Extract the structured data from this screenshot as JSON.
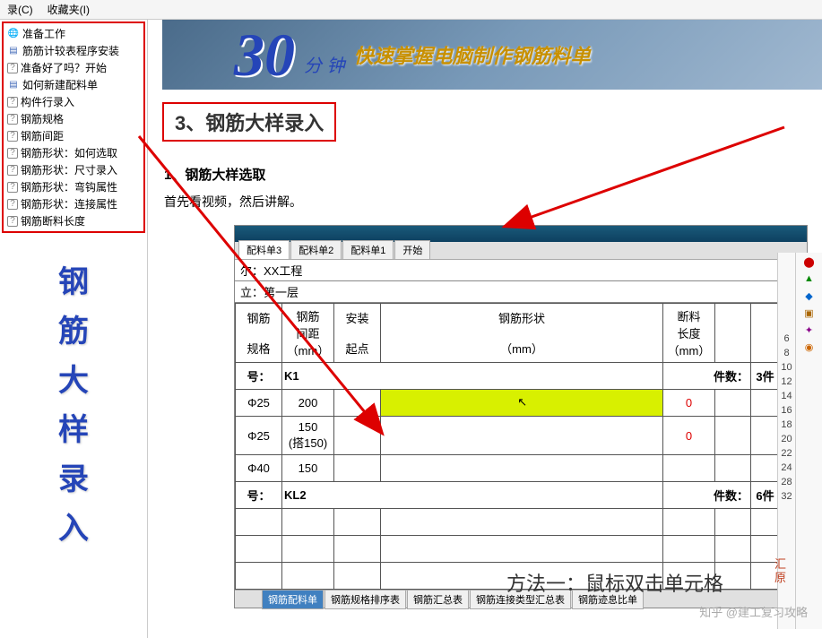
{
  "menu": {
    "item1": "录(C)",
    "item2": "收藏夹(I)"
  },
  "sidebar": {
    "items": [
      {
        "icon": "globe",
        "label": "准备工作"
      },
      {
        "icon": "doc",
        "label": "筋筋计较表程序安装"
      },
      {
        "icon": "q",
        "label": "准备好了吗？开始"
      },
      {
        "icon": "doc",
        "label": "如何新建配料单"
      },
      {
        "icon": "q",
        "label": "构件行录入"
      },
      {
        "icon": "q",
        "label": "钢筋规格"
      },
      {
        "icon": "q",
        "label": "钢筋间距"
      },
      {
        "icon": "q",
        "label": "钢筋形状：如何选取"
      },
      {
        "icon": "q",
        "label": "钢筋形状：尺寸录入"
      },
      {
        "icon": "q",
        "label": "钢筋形状：弯钩属性"
      },
      {
        "icon": "q",
        "label": "钢筋形状：连接属性"
      },
      {
        "icon": "q",
        "label": "钢筋断料长度"
      }
    ],
    "vertical": [
      "钢",
      "筋",
      "大",
      "样",
      "录",
      "入"
    ]
  },
  "banner": {
    "num": "30",
    "unit": "分 钟",
    "text": "快速掌握电脑制作钢筋料单"
  },
  "section": {
    "title": "3、钢筋大样录入",
    "sub": "1、钢筋大样选取",
    "body": "首先看视频，然后讲解。"
  },
  "app": {
    "tabs": [
      "配料单3",
      "配料单2",
      "配料单1",
      "开始"
    ],
    "info1": "尔：XX工程",
    "info2": "立：第一层",
    "headers": {
      "c1a": "钢筋",
      "c1b": "规格",
      "c2a": "钢筋",
      "c2b": "间距",
      "c2c": "（mm）",
      "c3a": "安装",
      "c3b": "起点",
      "c4a": "钢筋形状",
      "c4b": "（mm）",
      "c5a": "断料",
      "c5b": "长度",
      "c5c": "（mm）"
    },
    "rows": {
      "g1_label": "号：",
      "g1_val": "K1",
      "g1_cnt_label": "件数：",
      "g1_cnt": "3件",
      "r1_spec": "Φ25",
      "r1_space": "200",
      "r1_len": "0",
      "r2_spec": "Φ25",
      "r2_space_a": "150",
      "r2_space_b": "(搭150)",
      "r2_len": "0",
      "r3_spec": "Φ40",
      "r3_space": "150",
      "g2_label": "号：",
      "g2_val": "KL2",
      "g2_cnt_label": "件数：",
      "g2_cnt": "6件"
    },
    "bottom_tabs": [
      "钢筋配料单",
      "钢筋规格排序表",
      "钢筋汇总表",
      "钢筋连接类型汇总表",
      "钢筋迹息比单"
    ],
    "nums": [
      "6",
      "8",
      "10",
      "12",
      "14",
      "16",
      "18",
      "20",
      "22",
      "24",
      "28",
      "32"
    ],
    "hy": "汇\n原"
  },
  "caption": "方法一：鼠标双击单元格",
  "watermark": "知乎 @建工复习攻略"
}
